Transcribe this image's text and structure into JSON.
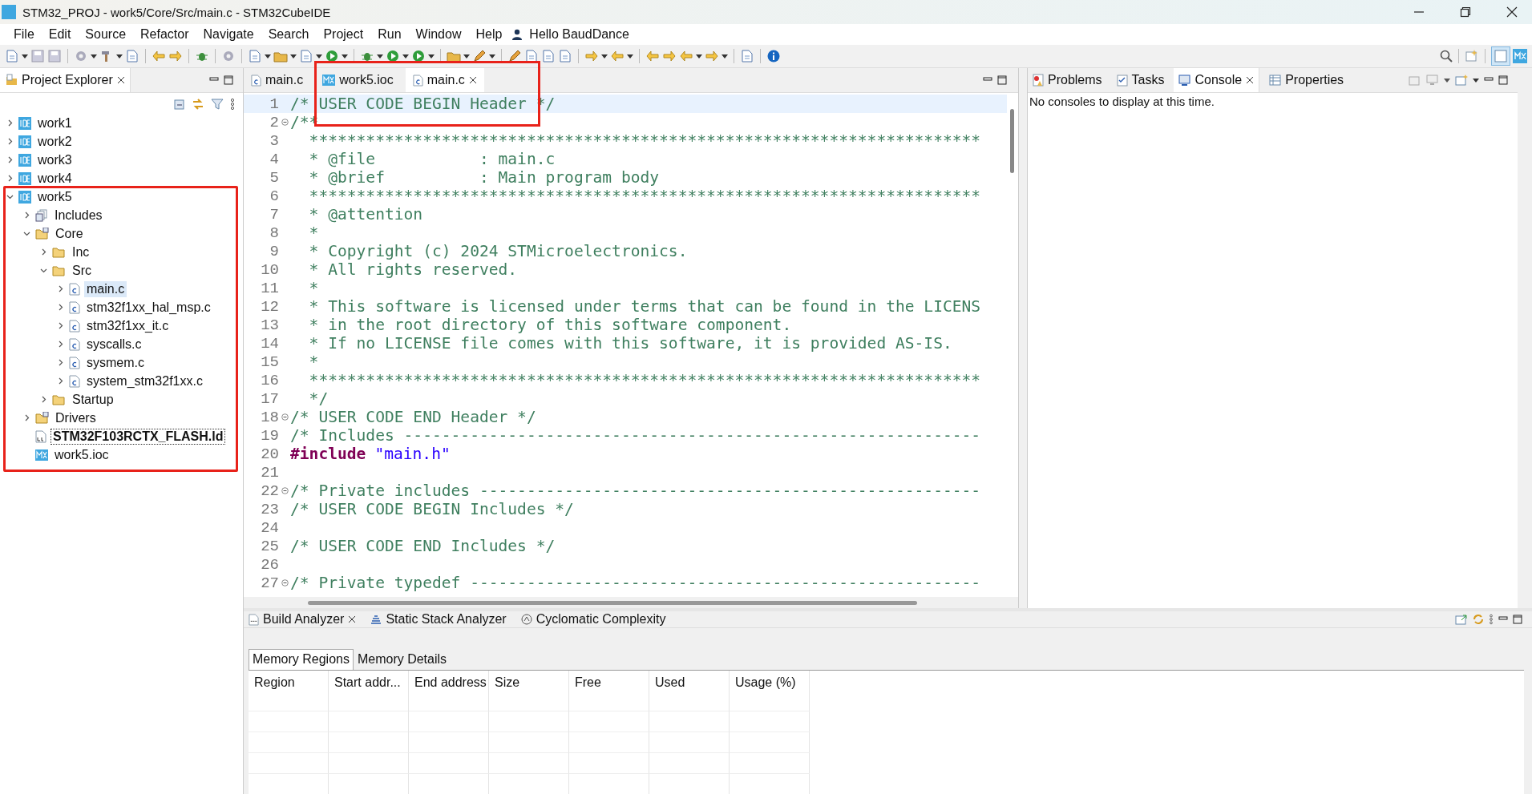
{
  "window": {
    "title": "STM32_PROJ - work5/Core/Src/main.c - STM32CubeIDE"
  },
  "menu": [
    "File",
    "Edit",
    "Source",
    "Refactor",
    "Navigate",
    "Search",
    "Project",
    "Run",
    "Window",
    "Help"
  ],
  "user": "Hello BaudDance",
  "explorer": {
    "tab": {
      "label": "Project Explorer",
      "selected": true
    },
    "tree": [
      {
        "label": "work1",
        "kind": "project",
        "expanded": false,
        "highlighted": false
      },
      {
        "label": "work2",
        "kind": "project",
        "expanded": false,
        "highlighted": false
      },
      {
        "label": "work3",
        "kind": "project",
        "expanded": false,
        "highlighted": false
      },
      {
        "label": "work4",
        "kind": "project",
        "expanded": false,
        "highlighted": false
      },
      {
        "label": "work5",
        "kind": "project",
        "expanded": true,
        "highlighted": true,
        "children": [
          {
            "label": "Includes",
            "kind": "includes",
            "expanded": false
          },
          {
            "label": "Core",
            "kind": "source-folder",
            "expanded": true,
            "children": [
              {
                "label": "Inc",
                "kind": "folder",
                "expanded": false
              },
              {
                "label": "Src",
                "kind": "folder",
                "expanded": true,
                "children": [
                  {
                    "label": "main.c",
                    "kind": "c-file",
                    "expanded": false,
                    "selected": true
                  },
                  {
                    "label": "stm32f1xx_hal_msp.c",
                    "kind": "c-file",
                    "expanded": false,
                    "selected": false
                  },
                  {
                    "label": "stm32f1xx_it.c",
                    "kind": "c-file",
                    "expanded": false,
                    "selected": false
                  },
                  {
                    "label": "syscalls.c",
                    "kind": "c-file",
                    "expanded": false,
                    "selected": false
                  },
                  {
                    "label": "sysmem.c",
                    "kind": "c-file",
                    "expanded": false,
                    "selected": false
                  },
                  {
                    "label": "system_stm32f1xx.c",
                    "kind": "c-file",
                    "expanded": false,
                    "selected": false
                  }
                ]
              },
              {
                "label": "Startup",
                "kind": "folder",
                "expanded": false
              }
            ]
          },
          {
            "label": "Drivers",
            "kind": "source-folder",
            "expanded": false
          },
          {
            "label": "STM32F103RCTX_FLASH.ld",
            "kind": "linker",
            "focused": true
          },
          {
            "label": "work5.ioc",
            "kind": "ioc",
            "focused": false
          }
        ]
      }
    ]
  },
  "editor": {
    "tabs": [
      {
        "label": "main.c",
        "kind": "c-file",
        "selected": false
      },
      {
        "label": "work5.ioc",
        "kind": "ioc",
        "selected": false
      },
      {
        "label": "main.c",
        "kind": "c-file",
        "selected": true
      }
    ],
    "lines": [
      {
        "number": "1",
        "kind": "comment",
        "text": "/* USER CODE BEGIN Header */",
        "current": true
      },
      {
        "number": "2",
        "kind": "comment",
        "text": "/**",
        "fold": true
      },
      {
        "number": "3",
        "kind": "comment",
        "text": "  ***********************************************************************"
      },
      {
        "number": "4",
        "kind": "comment",
        "text": "  * @file           : main.c"
      },
      {
        "number": "5",
        "kind": "comment",
        "text": "  * @brief          : Main program body"
      },
      {
        "number": "6",
        "kind": "comment",
        "text": "  ***********************************************************************"
      },
      {
        "number": "7",
        "kind": "comment",
        "text": "  * @attention"
      },
      {
        "number": "8",
        "kind": "comment",
        "text": "  *"
      },
      {
        "number": "9",
        "kind": "comment",
        "text": "  * Copyright (c) 2024 STMicroelectronics."
      },
      {
        "number": "10",
        "kind": "comment",
        "text": "  * All rights reserved."
      },
      {
        "number": "11",
        "kind": "comment",
        "text": "  *"
      },
      {
        "number": "12",
        "kind": "comment",
        "text": "  * This software is licensed under terms that can be found in the LICENS"
      },
      {
        "number": "13",
        "kind": "comment",
        "text": "  * in the root directory of this software component."
      },
      {
        "number": "14",
        "kind": "comment",
        "text": "  * If no LICENSE file comes with this software, it is provided AS-IS."
      },
      {
        "number": "15",
        "kind": "comment",
        "text": "  *"
      },
      {
        "number": "16",
        "kind": "comment",
        "text": "  ***********************************************************************"
      },
      {
        "number": "17",
        "kind": "comment",
        "text": "  */"
      },
      {
        "number": "18",
        "kind": "comment",
        "text": "/* USER CODE END Header */",
        "fold": true
      },
      {
        "number": "19",
        "kind": "comment",
        "text": "/* Includes -------------------------------------------------------------"
      },
      {
        "number": "20",
        "kind": "include",
        "directive": "#include",
        "path": "\"main.h\""
      },
      {
        "number": "21",
        "kind": "blank"
      },
      {
        "number": "22",
        "kind": "comment",
        "text": "/* Private includes -----------------------------------------------------",
        "fold": true
      },
      {
        "number": "23",
        "kind": "comment",
        "text": "/* USER CODE BEGIN Includes */"
      },
      {
        "number": "24",
        "kind": "blank"
      },
      {
        "number": "25",
        "kind": "comment",
        "text": "/* USER CODE END Includes */"
      },
      {
        "number": "26",
        "kind": "blank"
      },
      {
        "number": "27",
        "kind": "comment",
        "text": "/* Private typedef ------------------------------------------------------",
        "fold": true
      }
    ]
  },
  "views": {
    "tabs": [
      {
        "label": "Problems",
        "kind": "problems",
        "selected": false
      },
      {
        "label": "Tasks",
        "kind": "tasks",
        "selected": false
      },
      {
        "label": "Console",
        "kind": "console",
        "selected": true
      },
      {
        "label": "Properties",
        "kind": "properties",
        "selected": false
      }
    ],
    "message": "No consoles to display at this time."
  },
  "bottom": {
    "tabs": [
      {
        "label": "Build Analyzer",
        "kind": "build",
        "selected": true
      },
      {
        "label": "Static Stack Analyzer",
        "kind": "stack",
        "selected": false
      },
      {
        "label": "Cyclomatic Complexity",
        "kind": "complexity",
        "selected": false
      }
    ],
    "subtabs": [
      {
        "label": "Memory Regions",
        "selected": true
      },
      {
        "label": "Memory Details",
        "selected": false
      }
    ],
    "columns": [
      "Region",
      "Start addr...",
      "End address",
      "Size",
      "Free",
      "Used",
      "Usage (%)"
    ]
  }
}
